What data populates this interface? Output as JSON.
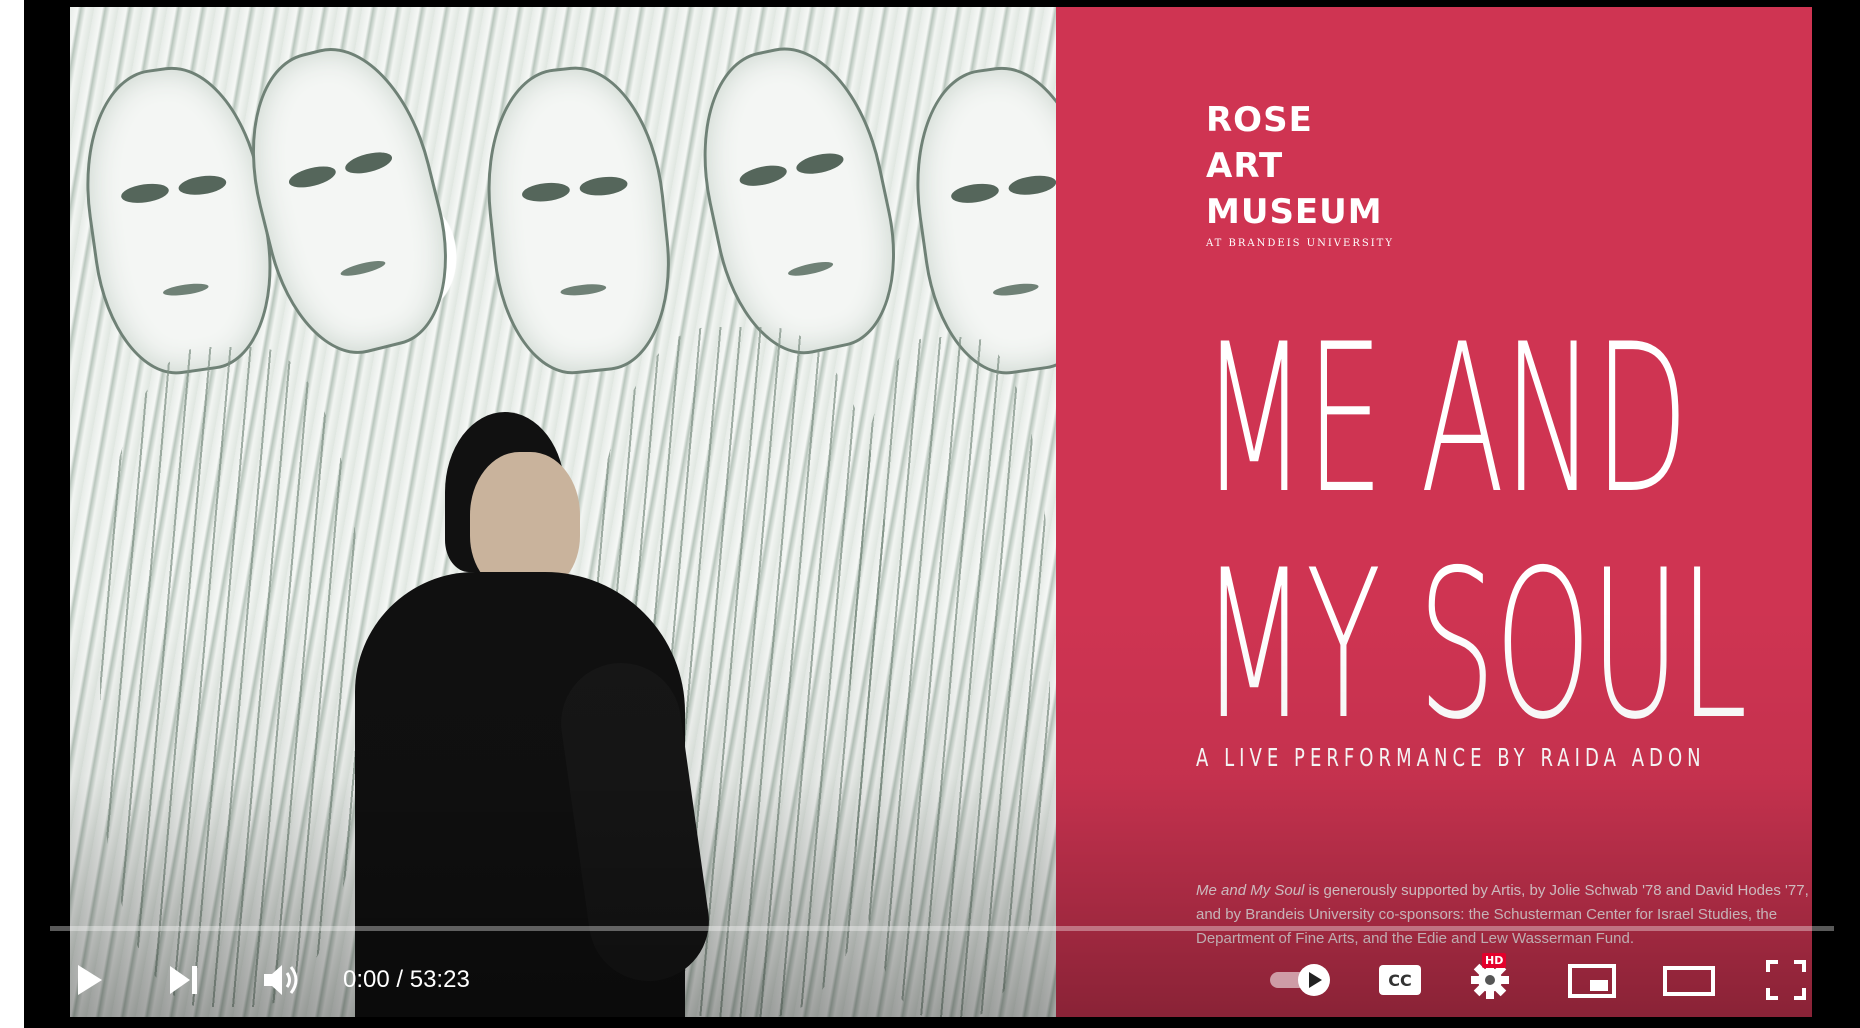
{
  "video": {
    "poster": {
      "logo_line1": "ROSE",
      "logo_line2": "ART",
      "logo_line3": "MUSEUM",
      "logo_sub": "AT BRANDEIS UNIVERSITY",
      "title_line1": "ME AND",
      "title_line2": "MY SOUL",
      "tagline": "A LIVE PERFORMANCE BY RAIDA ADON",
      "credits_italic": "Me and My Soul",
      "credits_text": " is generously supported by Artis, by Jolie Schwab '78 and David Hodes '77, and by Brandeis University co-sponsors: the Schusterman Center for Israel Studies, the Department of Fine Arts, and the Edie and Lew Wasserman Fund."
    },
    "colors": {
      "poster_bg": "#cf3452",
      "progress_played": "#ff0000",
      "hd_badge": "#e4002b"
    }
  },
  "controls": {
    "current_time": "0:00",
    "separator": " / ",
    "duration": "53:23",
    "progress_fraction": 0,
    "hd_label": "HD",
    "icons": {
      "play": "play-icon",
      "next": "skip-next-icon",
      "volume": "volume-icon",
      "autoplay": "autoplay-toggle-icon",
      "captions": "closed-captions-icon",
      "settings": "gear-icon",
      "miniplayer": "miniplayer-icon",
      "theater": "theater-mode-icon",
      "fullscreen": "fullscreen-icon"
    }
  }
}
